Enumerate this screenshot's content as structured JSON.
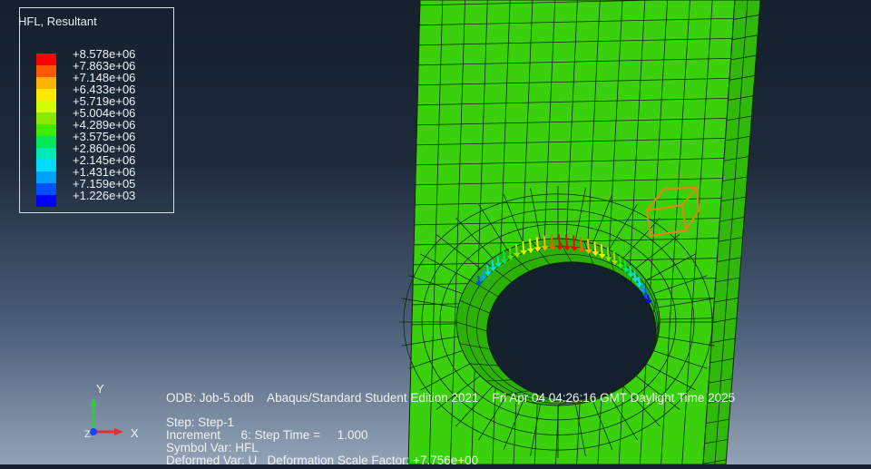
{
  "legend": {
    "title": "HFL, Resultant",
    "colors": [
      "#ff0000",
      "#ff5a00",
      "#ffb400",
      "#ffea00",
      "#d4ff00",
      "#8ae800",
      "#3dec00",
      "#00e85a",
      "#00e8b8",
      "#00dcff",
      "#00a0ff",
      "#0050ff",
      "#0000ff"
    ],
    "values": [
      "+8.578e+06",
      "+7.863e+06",
      "+7.148e+06",
      "+6.433e+06",
      "+5.719e+06",
      "+5.004e+06",
      "+4.289e+06",
      "+3.575e+06",
      "+2.860e+06",
      "+2.145e+06",
      "+1.431e+06",
      "+7.159e+05",
      "+1.226e+03"
    ]
  },
  "info": {
    "odb_line": "ODB: Job-5.odb    Abaqus/Standard Student Edition 2021    Fri Apr 04 04:26:16 GMT Daylight Time 2025",
    "step_line": "Step: Step-1",
    "increment_line": "Increment      6: Step Time =     1.000",
    "symbol_line": "Symbol Var: HFL",
    "deformed_line": "Deformed Var: U   Deformation Scale Factor: +7.756e+00"
  },
  "triad": {
    "y": "Y",
    "x": "X",
    "z": "Z"
  },
  "colors": {
    "mesh_fill": "#3ad10c",
    "mesh_shade": "#2fb408",
    "mesh_lines": "#0d2a05",
    "box_outline": "#d98a10"
  }
}
